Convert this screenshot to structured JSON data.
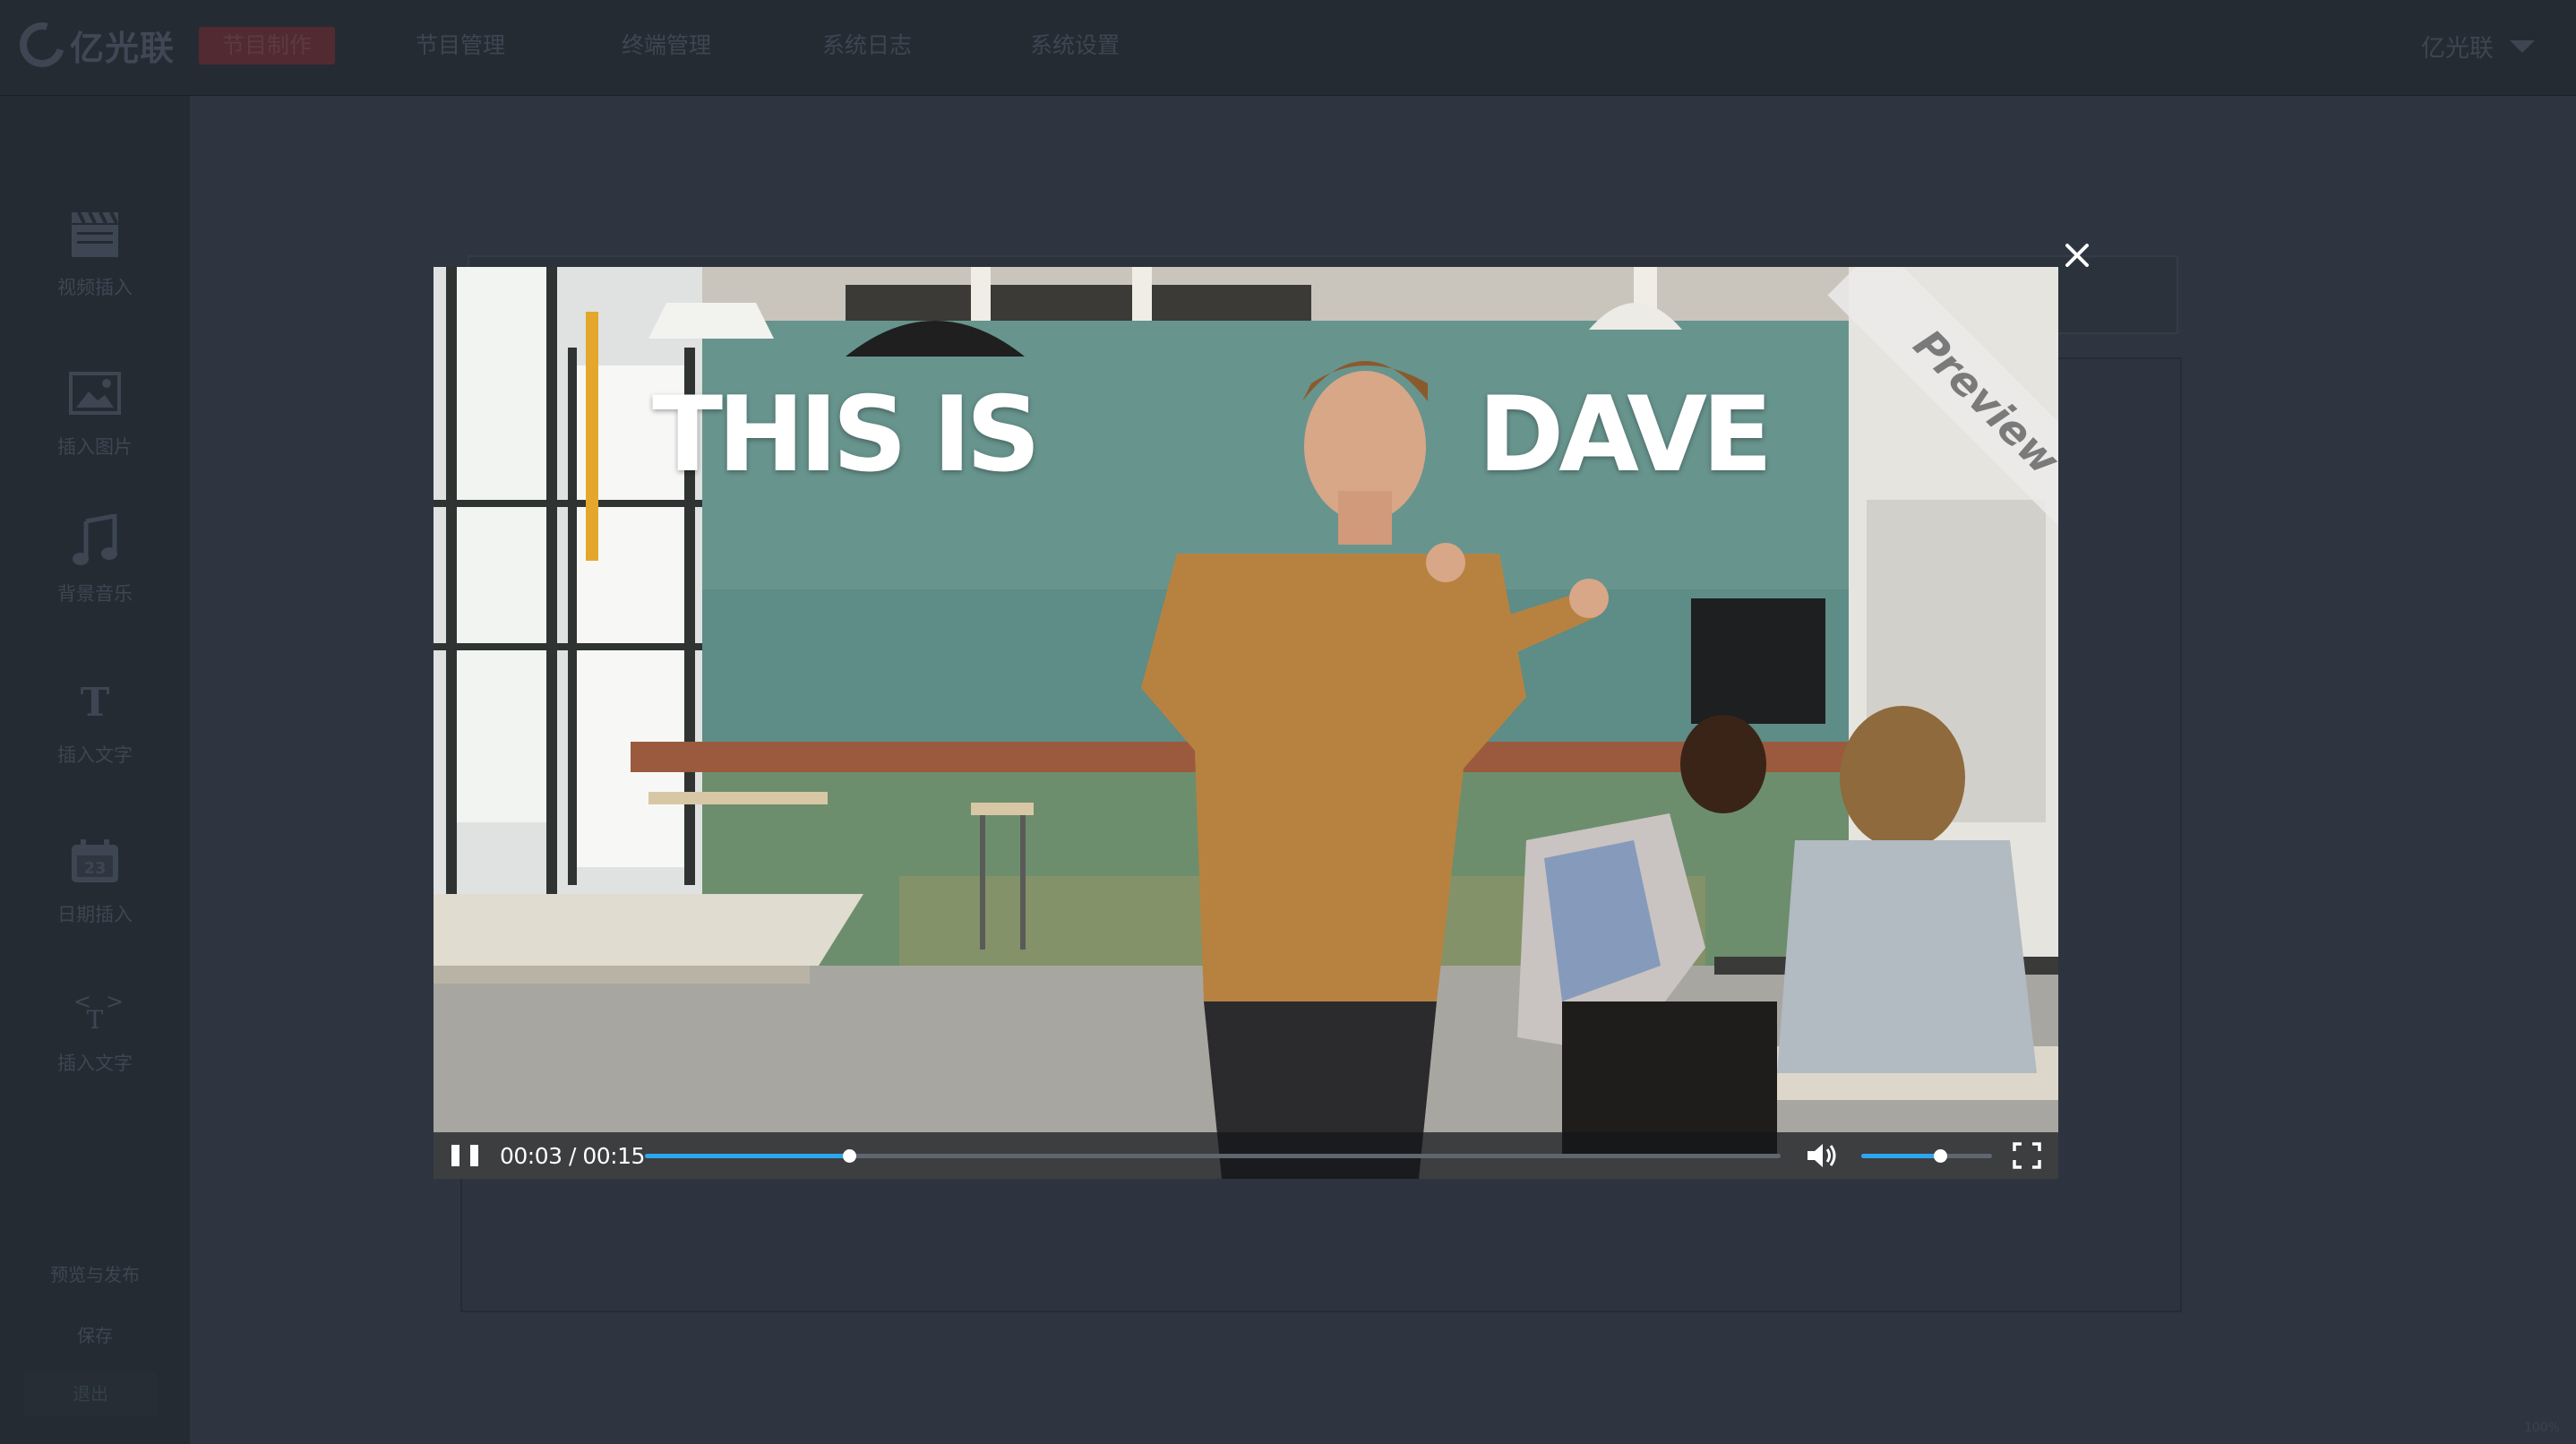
{
  "app": {
    "logo_text": "亿光联"
  },
  "nav": {
    "items": [
      {
        "label": "节目制作",
        "active": true
      },
      {
        "label": "节目管理",
        "active": false
      },
      {
        "label": "终端管理",
        "active": false
      },
      {
        "label": "系统日志",
        "active": false
      },
      {
        "label": "系统设置",
        "active": false
      }
    ],
    "user": "亿光联"
  },
  "sidebar": {
    "tools": [
      {
        "icon": "clapperboard-icon",
        "label": "视频插入"
      },
      {
        "icon": "image-icon",
        "label": "插入图片"
      },
      {
        "icon": "music-note-icon",
        "label": "背景音乐"
      },
      {
        "icon": "text-icon",
        "label": "插入文字"
      },
      {
        "icon": "calendar-icon",
        "label": "日期插入",
        "icon_text": "23"
      },
      {
        "icon": "code-text-icon",
        "label": "插入文字"
      }
    ],
    "actions": {
      "preview_publish": "预览与发布",
      "save": "保存",
      "exit": "退出"
    }
  },
  "workspace": {
    "zoom_label": "100%"
  },
  "video": {
    "title_left": "THIS IS",
    "title_right": "DAVE",
    "watermark": "Preview",
    "current_time": "00:03",
    "duration": "00:15",
    "time_display": "00:03 / 00:15",
    "progress_fraction": 0.18,
    "volume_fraction": 0.6,
    "state": "playing",
    "accent_color": "#2da6f0",
    "title_bar_color": "#e5a62c"
  }
}
